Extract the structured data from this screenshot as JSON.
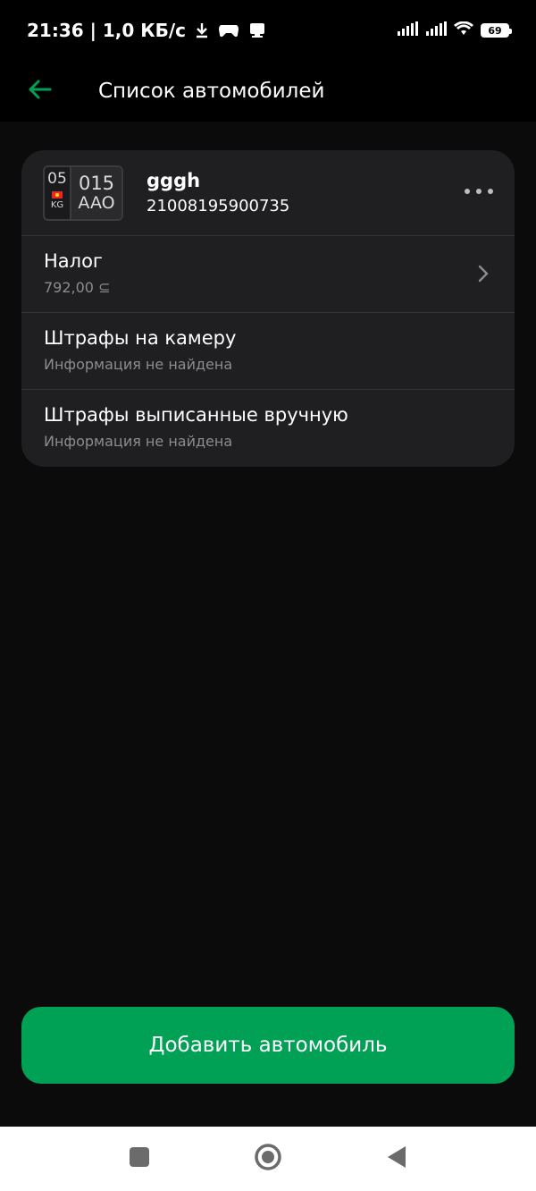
{
  "status_bar": {
    "time_speed": "21:36 | 1,0 КБ/с",
    "battery": "69",
    "icons": [
      "download-icon",
      "game-controller-icon",
      "notification-icon",
      "signal-icon",
      "signal-icon",
      "wifi-icon",
      "battery-icon"
    ]
  },
  "header": {
    "title": "Список автомобилей",
    "back_icon": "arrow-left-icon"
  },
  "car": {
    "plate_region": "05",
    "plate_country": "KG",
    "plate_number": "015",
    "plate_letters": "AAO",
    "name": "gggh",
    "id": "21008195900735",
    "menu_icon": "more-horizontal-icon"
  },
  "sections": [
    {
      "title": "Налог",
      "subtitle": "792,00 ⊆"
    },
    {
      "title": "Штрафы на камеру",
      "subtitle": "Информация не найдена"
    },
    {
      "title": "Штрафы выписанные вручную",
      "subtitle": "Информация не найдена"
    }
  ],
  "add_button": {
    "label": "Добавить автомобиль"
  },
  "colors": {
    "accent": "#00a055",
    "background": "#0b0b0b",
    "card": "#1f1f21"
  }
}
